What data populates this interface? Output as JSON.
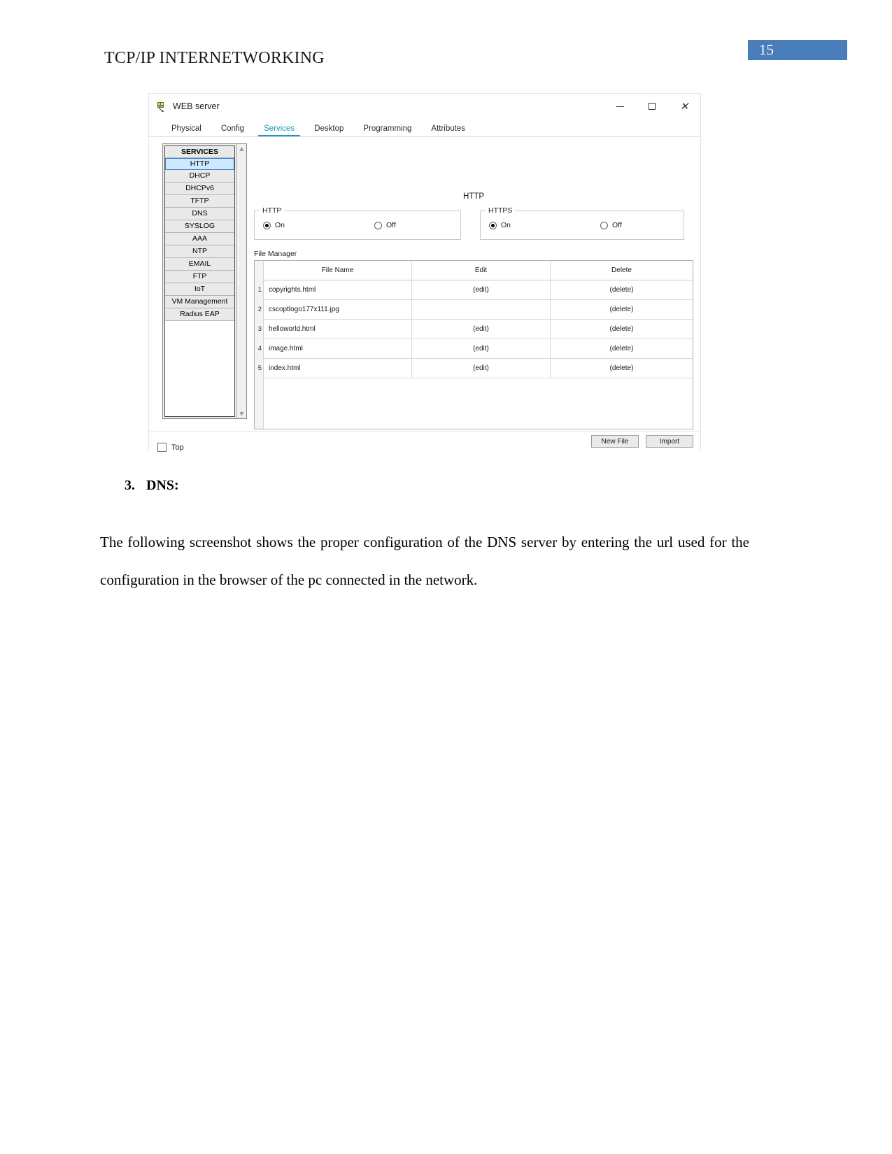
{
  "document": {
    "header_title": "TCP/IP INTERNETWORKING",
    "page_number": "15",
    "heading_number": "3.",
    "heading_text": "DNS:",
    "paragraph": "The following screenshot shows the proper configuration of the DNS server by entering the url used for the configuration in the browser of the pc connected in the network."
  },
  "screenshot": {
    "window": {
      "title": "WEB server",
      "icon": "server-icon",
      "minimize_label": "–",
      "maximize_label": "□",
      "close_label": "✕"
    },
    "tabs": [
      {
        "label": "Physical",
        "active": false
      },
      {
        "label": "Config",
        "active": false
      },
      {
        "label": "Services",
        "active": true
      },
      {
        "label": "Desktop",
        "active": false
      },
      {
        "label": "Programming",
        "active": false
      },
      {
        "label": "Attributes",
        "active": false
      }
    ],
    "sidebar": {
      "header": "SERVICES",
      "selected": "HTTP",
      "items": [
        "HTTP",
        "DHCP",
        "DHCPv6",
        "TFTP",
        "DNS",
        "SYSLOG",
        "AAA",
        "NTP",
        "EMAIL",
        "FTP",
        "IoT",
        "VM Management",
        "Radius EAP"
      ],
      "scroll_up": "▲",
      "scroll_down": "▼"
    },
    "content": {
      "title": "HTTP",
      "http_group": {
        "legend": "HTTP",
        "on_label": "On",
        "off_label": "Off",
        "selected": "On"
      },
      "https_group": {
        "legend": "HTTPS",
        "on_label": "On",
        "off_label": "Off",
        "selected": "On"
      },
      "file_manager": {
        "label": "File Manager",
        "columns": [
          "File Name",
          "Edit",
          "Delete"
        ],
        "rows": [
          {
            "num": "1",
            "name": "copyrights.html",
            "edit": "(edit)",
            "delete": "(delete)"
          },
          {
            "num": "2",
            "name": "cscoptlogo177x111.jpg",
            "edit": "",
            "delete": "(delete)"
          },
          {
            "num": "3",
            "name": "helloworld.html",
            "edit": "(edit)",
            "delete": "(delete)"
          },
          {
            "num": "4",
            "name": "image.html",
            "edit": "(edit)",
            "delete": "(delete)"
          },
          {
            "num": "5",
            "name": "index.html",
            "edit": "(edit)",
            "delete": "(delete)"
          }
        ],
        "new_file_button": "New File",
        "import_button": "Import"
      },
      "footer": {
        "top_checkbox_label": "Top",
        "top_checked": false
      }
    },
    "colors": {
      "accent_tab": "#1e9ab8",
      "selection": "#cde8ff",
      "page_badge": "#4a7ebb"
    }
  }
}
